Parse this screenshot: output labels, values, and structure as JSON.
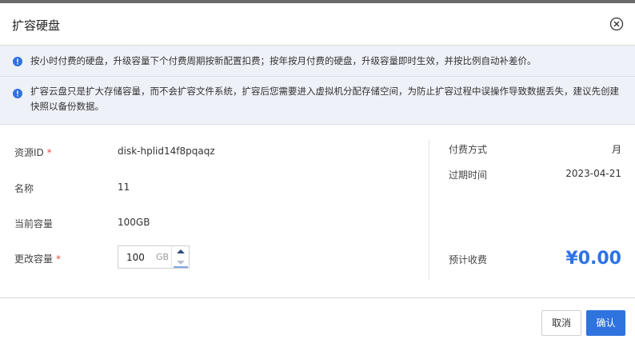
{
  "dialog": {
    "title": "扩容硬盘"
  },
  "notices": [
    {
      "text": "按小时付费的硬盘，升级容量下个付费周期按新配置扣费；按年按月付费的硬盘，升级容量即时生效，并按比例自动补差价。"
    },
    {
      "text": "扩容云盘只是扩大存储容量，而不会扩容文件系统，扩容后您需要进入虚拟机分配存储空间，为防止扩容过程中误操作导致数据丢失，建议先创建快照以备份数据。"
    }
  ],
  "form": {
    "resource_id_label": "资源ID",
    "resource_id_value": "disk-hplid14f8pqaqz",
    "name_label": "名称",
    "name_value": "11",
    "current_capacity_label": "当前容量",
    "current_capacity_value": "100GB",
    "change_capacity_label": "更改容量",
    "change_capacity_value": "100",
    "change_capacity_unit": "GB",
    "required_mark": "*"
  },
  "summary": {
    "payment_method_label": "付费方式",
    "payment_method_value": "月",
    "expiry_label": "过期时间",
    "expiry_value": "2023-04-21",
    "estimated_fee_label": "预计收费",
    "estimated_fee_value": "¥0.00"
  },
  "buttons": {
    "cancel": "取消",
    "confirm": "确认"
  },
  "colors": {
    "accent": "#2f73df",
    "notice_bg": "#eef1f8",
    "required": "#e54d42"
  }
}
